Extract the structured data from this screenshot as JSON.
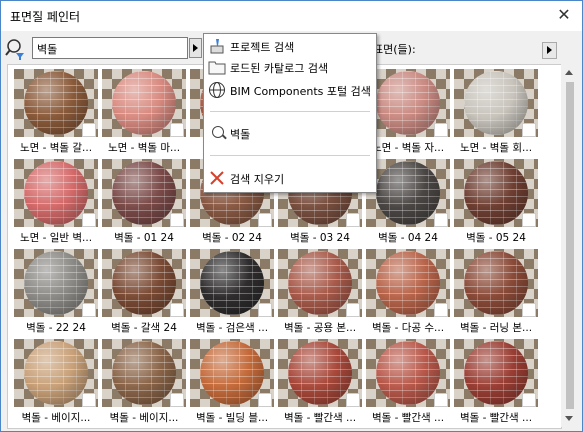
{
  "window": {
    "title": "표면질 페인터",
    "close_label": "✕"
  },
  "search": {
    "value": "벽돌"
  },
  "surfaces_label": "표면(들):",
  "dropdown": {
    "items": [
      {
        "icon": "brush-icon",
        "label": "프로젝트 검색"
      },
      {
        "icon": "folder-icon",
        "label": "로드된 카탈로그 검색"
      },
      {
        "icon": "globe-icon",
        "label": "BIM Components 포털 검색"
      },
      {
        "icon": "search-icon",
        "label": "벽돌"
      },
      {
        "icon": "clear-icon",
        "label": "검색 지우기"
      }
    ]
  },
  "materials": [
    {
      "label": "노면 - 벽돌 갈...",
      "color": "#8a5a3a"
    },
    {
      "label": "노면 - 벽돌 마...",
      "color": "#d88a80"
    },
    {
      "label": "",
      "color": "#a35a44"
    },
    {
      "label": "",
      "color": "#9a5a4a"
    },
    {
      "label": "노면 - 벽돌 자...",
      "color": "#c98a82"
    },
    {
      "label": "노면 - 벽돌 회...",
      "color": "#c8c4bc"
    },
    {
      "label": "노면 - 일반 벽...",
      "color": "#d46a6a"
    },
    {
      "label": "벽돌 - 01 24",
      "color": "#7a4a48"
    },
    {
      "label": "벽돌 - 02 24",
      "color": "#8a5a44"
    },
    {
      "label": "벽돌 - 03 24",
      "color": "#7a5040"
    },
    {
      "label": "벽돌 - 04 24",
      "color": "#4a4644"
    },
    {
      "label": "벽돌 - 05 24",
      "color": "#6e3e32"
    },
    {
      "label": "벽돌 - 22 24",
      "color": "#8c8a86"
    },
    {
      "label": "벽돌 - 갈색 24",
      "color": "#7a4a34"
    },
    {
      "label": "벽돌 - 검은색 ...",
      "color": "#2e2c2c"
    },
    {
      "label": "벽돌 - 공용 본...",
      "color": "#a85a4a"
    },
    {
      "label": "벽돌 - 다공 수...",
      "color": "#b8644a"
    },
    {
      "label": "벽돌 - 러닝 본...",
      "color": "#8a4a38"
    },
    {
      "label": "벽돌 - 베이지...",
      "color": "#c8a078"
    },
    {
      "label": "벽돌 - 베이지...",
      "color": "#8a6448"
    },
    {
      "label": "벽돌 - 빌딩 블...",
      "color": "#c46a3a"
    },
    {
      "label": "벽돌 - 빨간색 ...",
      "color": "#a8483a"
    },
    {
      "label": "벽돌 - 빨간색 ...",
      "color": "#b8584a"
    },
    {
      "label": "벽돌 - 빨간색 ...",
      "color": "#9a3e34"
    }
  ]
}
